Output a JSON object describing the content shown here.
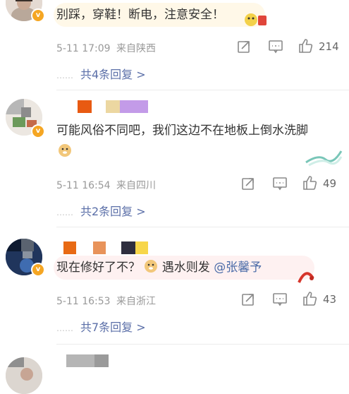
{
  "comments": [
    {
      "text": "别踩，穿鞋！断电，注意安全！",
      "time": "5-11 17:09",
      "location": "来自陕西",
      "likes": "214",
      "replies": "共4条回复 >"
    },
    {
      "text": "可能风俗不同吧，我们这边不在地板上倒水洗脚",
      "time": "5-11 16:54",
      "location": "来自四川",
      "likes": "49",
      "replies": "共2条回复 >"
    },
    {
      "text_before": "现在修好了不？",
      "text_after": "遇水则发",
      "mention": "@张馨予",
      "time": "5-11 16:53",
      "location": "来自浙江",
      "likes": "43",
      "replies": "共7条回复 >"
    }
  ],
  "icons": {
    "share": "share-icon",
    "comment": "comment-icon",
    "like": "thumbs-up-icon",
    "verified": "verified-badge-icon",
    "doge": "doge-emoji-icon"
  },
  "colors": {
    "link": "#5b6fa8",
    "badge": "#f5a623",
    "meta": "#999999"
  }
}
